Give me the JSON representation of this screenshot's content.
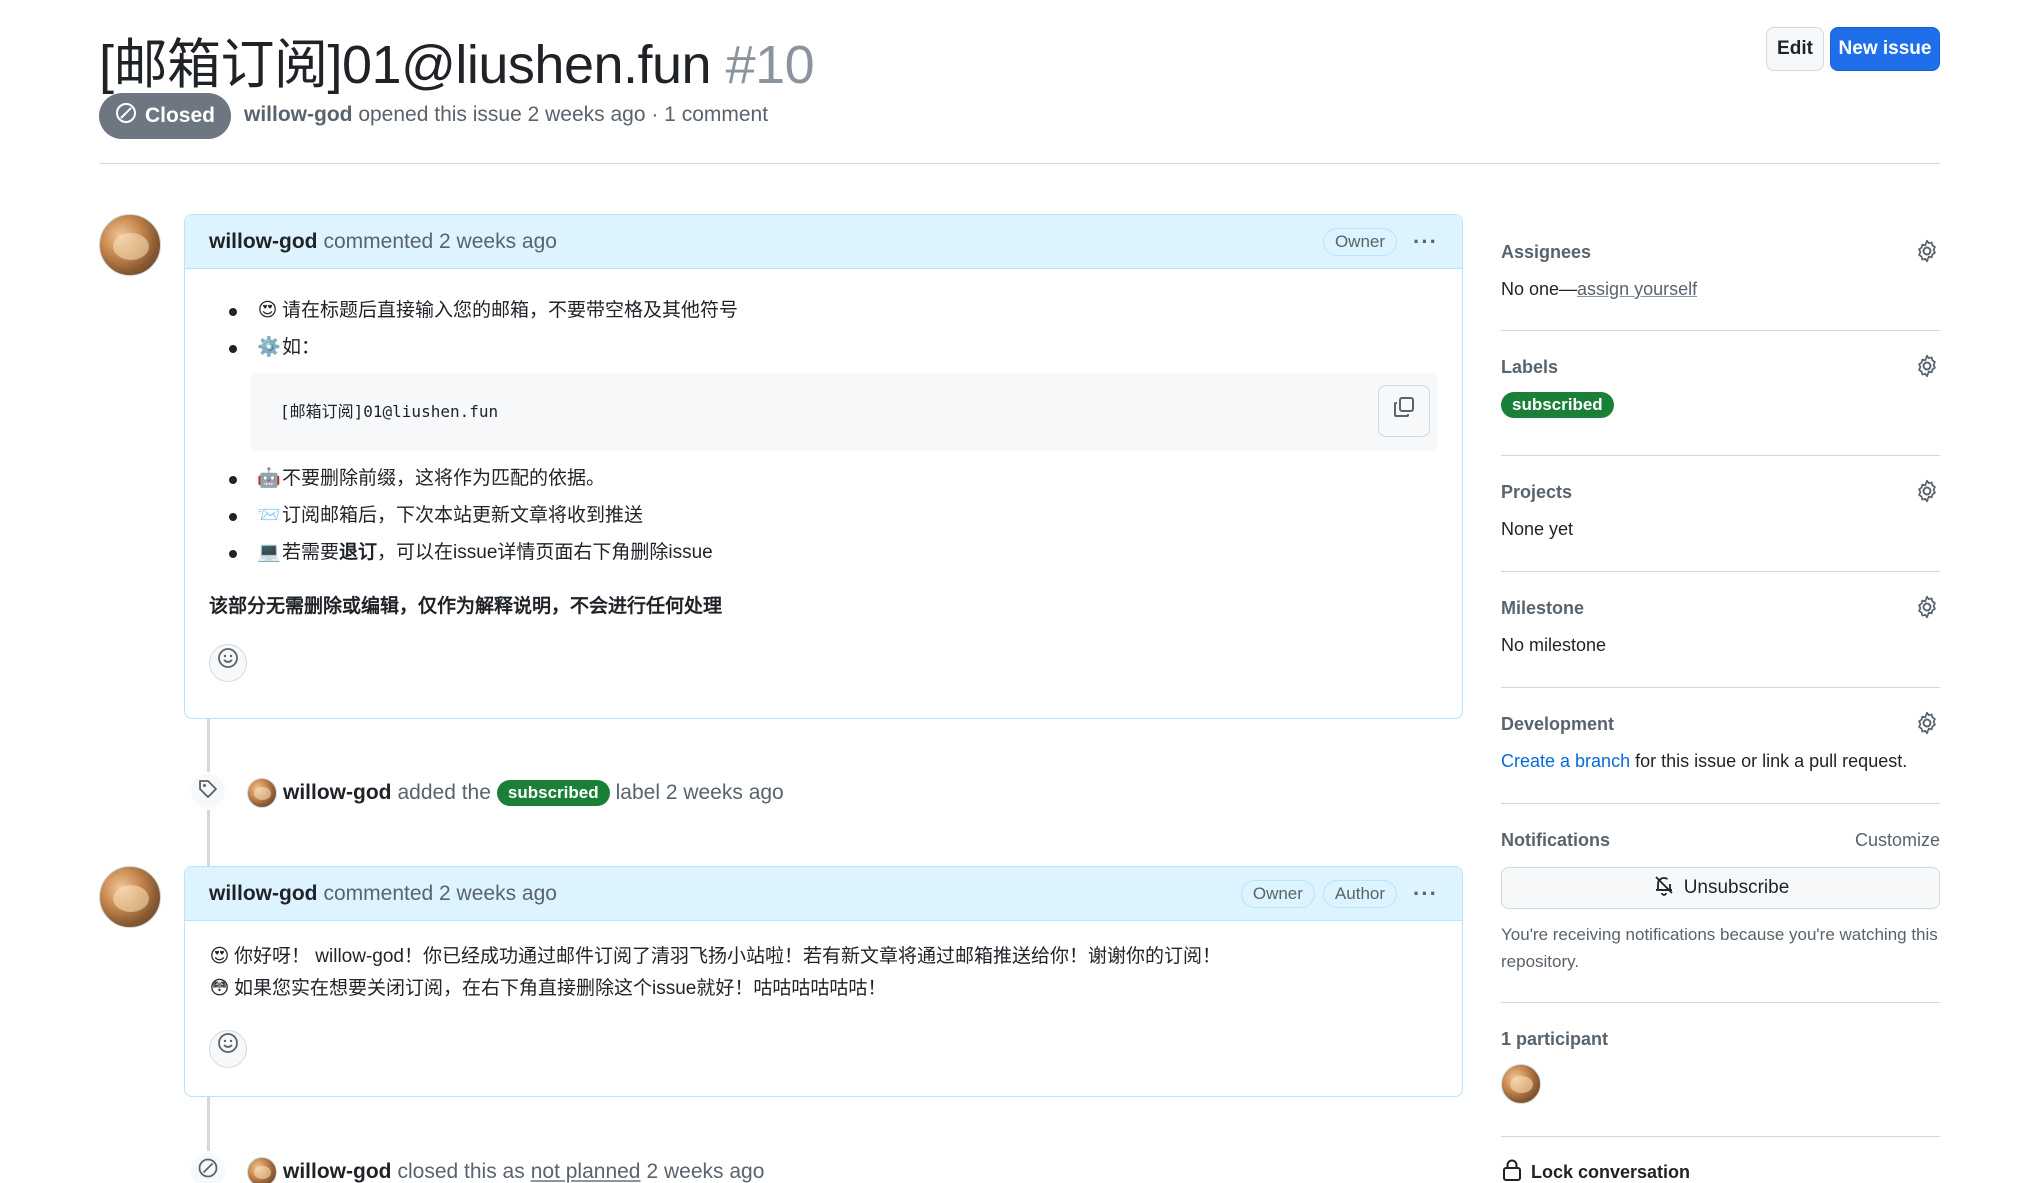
{
  "issue": {
    "title": "[邮箱订阅]01@liushen.fun",
    "number": "#10",
    "state": "Closed",
    "author": "willow-god",
    "meta_text": "opened this issue 2 weeks ago · 1 comment"
  },
  "header_buttons": {
    "edit": "Edit",
    "new_issue": "New issue"
  },
  "comment1": {
    "author": "willow-god",
    "time": "commented 2 weeks ago",
    "badges": [
      "Owner"
    ],
    "bullets": [
      {
        "emoji": "😍",
        "text": "请在标题后直接输入您的邮箱，不要带空格及其他符号"
      },
      {
        "emoji": "⚙️",
        "text": "如："
      }
    ],
    "code": "[邮箱订阅]01@liushen.fun",
    "bullets2": [
      {
        "emoji": "🤖",
        "text": "不要删除前缀，这将作为匹配的依据。"
      },
      {
        "emoji": "📨",
        "text": "订阅邮箱后，下次本站更新文章将收到推送"
      },
      {
        "emoji": "💻",
        "text_a": "若需要",
        "text_b": "退订",
        "text_c": "，可以在issue详情页面右下角删除issue"
      }
    ],
    "note": "该部分无需删除或编辑，仅作为解释说明，不会进行任何处理"
  },
  "event_label": {
    "actor": "willow-god",
    "pre": "added the",
    "label": "subscribed",
    "post": "label 2 weeks ago"
  },
  "comment2": {
    "author": "willow-god",
    "time": "commented 2 weeks ago",
    "badges": [
      "Owner",
      "Author"
    ],
    "line1": "你好呀！ willow-god！你已经成功通过邮件订阅了清羽飞扬小站啦！若有新文章将通过邮箱推送给你！谢谢你的订阅！",
    "line2": "如果您实在想要关闭订阅，在右下角直接删除这个issue就好！咕咕咕咕咕咕！",
    "emoji1": "😍",
    "emoji2": "😳"
  },
  "event_closed": {
    "actor": "willow-god",
    "pre": "closed this as",
    "reason": "not planned",
    "post": "2 weeks ago"
  },
  "sidebar": {
    "assignees": {
      "title": "Assignees",
      "value_a": "No one—",
      "value_link": "assign yourself"
    },
    "labels": {
      "title": "Labels",
      "value": "subscribed"
    },
    "projects": {
      "title": "Projects",
      "value": "None yet"
    },
    "milestone": {
      "title": "Milestone",
      "value": "No milestone"
    },
    "development": {
      "title": "Development",
      "link": "Create a branch",
      "rest": "for this issue or link a pull request."
    },
    "notifications": {
      "title": "Notifications",
      "customize": "Customize",
      "button": "Unsubscribe",
      "note": "You're receiving notifications because you're watching this repository."
    },
    "participants": {
      "title": "1 participant"
    },
    "lock": "Lock conversation"
  },
  "colors": {
    "accent": "#1f6feb",
    "label_green": "#1a7f37",
    "closed_gray": "#6e7781",
    "comment_head": "#ddf4ff"
  }
}
